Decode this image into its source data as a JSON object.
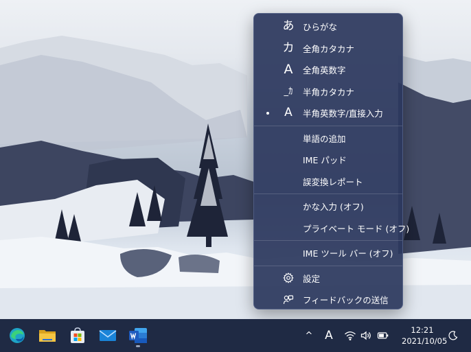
{
  "ime_menu": {
    "items": [
      {
        "icon": "hiragana-a-icon",
        "glyph": "あ",
        "label": "ひらがな",
        "selected": false
      },
      {
        "icon": "fullwidth-katakana-ka-icon",
        "glyph": "カ",
        "label": "全角カタカナ",
        "selected": false
      },
      {
        "icon": "fullwidth-alphanumeric-a-icon",
        "glyph": "A",
        "label": "全角英数字",
        "selected": false
      },
      {
        "icon": "halfwidth-katakana-ka-icon",
        "glyph": "_ｶ",
        "label": "半角カタカナ",
        "selected": false
      },
      {
        "icon": "halfwidth-alphanumeric-a-icon",
        "glyph": "A",
        "label": "半角英数字/直接入力",
        "selected": true
      }
    ],
    "tools": [
      {
        "label": "単語の追加"
      },
      {
        "label": "IME パッド"
      },
      {
        "label": "誤変換レポート"
      }
    ],
    "options": [
      {
        "label": "かな入力 (オフ)"
      },
      {
        "label": "プライベート モード (オフ)"
      }
    ],
    "toolbar": {
      "label": "IME ツール バー (オフ)"
    },
    "footer": [
      {
        "icon": "gear-icon",
        "label": "設定"
      },
      {
        "icon": "feedback-icon",
        "label": "フィードバックの送信"
      }
    ]
  },
  "taskbar": {
    "apps": [
      {
        "name": "edge-app-icon",
        "active": false
      },
      {
        "name": "file-explorer-app-icon",
        "active": false
      },
      {
        "name": "microsoft-store-app-icon",
        "active": false
      },
      {
        "name": "mail-app-icon",
        "active": false
      },
      {
        "name": "word-app-icon",
        "active": true
      }
    ],
    "tray": {
      "overflow_glyph": "^",
      "ime_mode_glyph": "A",
      "clock_time": "12:21",
      "clock_date": "2021/10/05"
    }
  },
  "colors": {
    "menu_bg": "#2c385e",
    "taskbar_bg": "#1f2a44",
    "word_blue": "#1e5bbf",
    "edge_teal": "#1fa4c6",
    "folder_yellow": "#f5c542",
    "mail_blue": "#1a84d8"
  }
}
